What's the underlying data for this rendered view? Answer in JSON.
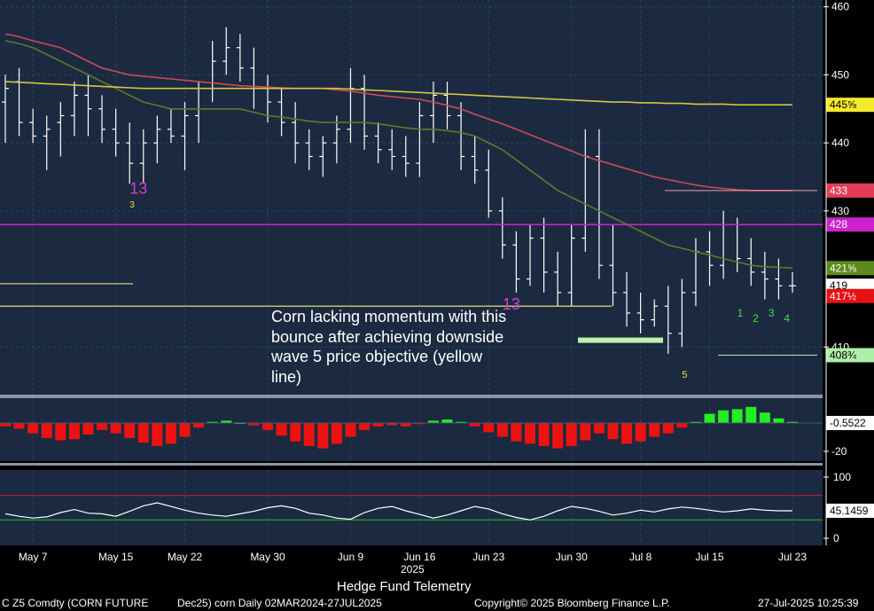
{
  "footer": {
    "ticker": "C Z5 Comdty (CORN FUTURE",
    "contract": "Dec25) corn  Daily 02MAR2024-27JUL2025",
    "copyright": "Copyright© 2025 Bloomberg Finance L.P.",
    "timestamp": "27-Jul-2025 10:25:39"
  },
  "colors": {
    "background": "#1b2a40",
    "up_candle": "#ffffff",
    "ma_short": "#5e7a2a",
    "ma_mid": "#d0485a",
    "ma_long": "#d6c442",
    "level_yellow": "#e4e070",
    "level_magenta": "#d020d0",
    "momentum_up": "#22ee22",
    "momentum_down": "#ee1111"
  },
  "chart_data": {
    "type": "line",
    "title": "Hedge Fund Telemetry",
    "year_label": "2025",
    "annotation": "Corn lacking momentum with this bounce after achieving downside wave 5 price objective (yellow line)",
    "x_labels": [
      "May 7",
      "May 15",
      "May 22",
      "May 30",
      "Jun 9",
      "Jun 16",
      "Jun 23",
      "Jun 30",
      "Jul 8",
      "Jul 15",
      "Jul 23"
    ],
    "x_label_index": [
      2,
      8,
      13,
      19,
      25,
      30,
      35,
      41,
      46,
      51,
      57
    ],
    "price_axis": {
      "ticks": [
        460,
        450,
        440,
        430,
        410
      ],
      "ylim": [
        403,
        461
      ]
    },
    "price_badges": [
      {
        "label": "445⅝",
        "value": 445.6,
        "color": "#f3ea2a"
      },
      {
        "label": "433",
        "value": 433,
        "color": "#e43d5a"
      },
      {
        "label": "428",
        "value": 428,
        "color": "#cc22cc"
      },
      {
        "label": "421⅝",
        "value": 421.6,
        "color": "#5c8a1c"
      },
      {
        "label": "419",
        "value": 419,
        "color": "#ffffff"
      },
      {
        "label": "417½",
        "value": 417.5,
        "color": "#e81111"
      },
      {
        "label": "408¾",
        "value": 408.8,
        "color": "#aef0a8"
      }
    ],
    "ohlc": [
      [
        446,
        450,
        440,
        448
      ],
      [
        449,
        451,
        441,
        443
      ],
      [
        443,
        445,
        440,
        441
      ],
      [
        441,
        444,
        436,
        442
      ],
      [
        443,
        446,
        438,
        444
      ],
      [
        444,
        449,
        441,
        447
      ],
      [
        447,
        450,
        441,
        445
      ],
      [
        445,
        447,
        440,
        442
      ],
      [
        442,
        445,
        438,
        440
      ],
      [
        440,
        443,
        434,
        437
      ],
      [
        437,
        442,
        434,
        440
      ],
      [
        440,
        444,
        437,
        442
      ],
      [
        442,
        445,
        440,
        441
      ],
      [
        441,
        446,
        436,
        444
      ],
      [
        444,
        449,
        440,
        448
      ],
      [
        448,
        455,
        446,
        452
      ],
      [
        452,
        457,
        450,
        454
      ],
      [
        454,
        456,
        449,
        451
      ],
      [
        451,
        454,
        445,
        448
      ],
      [
        448,
        450,
        443,
        446
      ],
      [
        446,
        448,
        441,
        443
      ],
      [
        443,
        446,
        437,
        440
      ],
      [
        440,
        442,
        436,
        438
      ],
      [
        438,
        441,
        435,
        440
      ],
      [
        440,
        444,
        437,
        442
      ],
      [
        442,
        451,
        440,
        448
      ],
      [
        448,
        450,
        439,
        441
      ],
      [
        441,
        443,
        437,
        439
      ],
      [
        439,
        442,
        436,
        438
      ],
      [
        438,
        441,
        435,
        437
      ],
      [
        437,
        446,
        435,
        444
      ],
      [
        444,
        449,
        440,
        447
      ],
      [
        447,
        449,
        442,
        444
      ],
      [
        444,
        446,
        436,
        438
      ],
      [
        438,
        441,
        434,
        436
      ],
      [
        436,
        439,
        429,
        430
      ],
      [
        430,
        432,
        423,
        425
      ],
      [
        425,
        427,
        418,
        420
      ],
      [
        420,
        428,
        419,
        426
      ],
      [
        426,
        429,
        418,
        421
      ],
      [
        421,
        424,
        416,
        418
      ],
      [
        418,
        428,
        416,
        426
      ],
      [
        426,
        442,
        424,
        438
      ],
      [
        438,
        442,
        420,
        422
      ],
      [
        422,
        428,
        416,
        418
      ],
      [
        418,
        421,
        413,
        415
      ],
      [
        415,
        418,
        412,
        414
      ],
      [
        414,
        417,
        413,
        416
      ],
      [
        416,
        419,
        409,
        412
      ],
      [
        412,
        420,
        410,
        418
      ],
      [
        418,
        426,
        416,
        424
      ],
      [
        424,
        427,
        419,
        422
      ],
      [
        422,
        430,
        420,
        428
      ],
      [
        428,
        429,
        421,
        423
      ],
      [
        423,
        426,
        419,
        421
      ],
      [
        421,
        424,
        417,
        420
      ],
      [
        420,
        423,
        417,
        419
      ],
      [
        419,
        421,
        418,
        419
      ]
    ],
    "series": [
      {
        "name": "",
        "color": "#5e7a2a",
        "values": [
          455,
          454.6,
          454,
          453,
          452,
          451,
          450,
          449,
          448,
          447,
          446,
          445.5,
          445,
          445,
          445,
          445,
          445,
          445,
          444.5,
          444,
          443.8,
          443.5,
          443.2,
          443,
          443,
          443,
          443,
          442.8,
          442.5,
          442.2,
          442,
          442,
          441.8,
          441.5,
          441,
          440,
          439,
          437.5,
          436,
          434.5,
          433,
          432,
          431,
          430,
          429,
          428,
          427,
          426,
          425,
          424.5,
          424,
          423.5,
          423,
          422.5,
          422,
          421.8,
          421.7,
          421.6
        ]
      },
      {
        "name": "",
        "color": "#d0485a",
        "values": [
          456,
          455.6,
          455,
          454.5,
          454,
          453,
          452,
          451,
          450.5,
          450,
          449.8,
          449.6,
          449.4,
          449.2,
          449,
          448.8,
          448.6,
          448.4,
          448.3,
          448.2,
          448.1,
          448,
          448,
          448,
          447.8,
          447.6,
          447.3,
          447,
          446.8,
          446.6,
          446.4,
          446,
          445.5,
          445,
          444.2,
          443.5,
          442.8,
          442,
          441.2,
          440.4,
          439.6,
          438.8,
          438,
          437.4,
          436.8,
          436.2,
          435.6,
          435,
          434.6,
          434.2,
          433.8,
          433.5,
          433.3,
          433.1,
          433,
          433,
          433,
          433
        ]
      },
      {
        "name": "",
        "color": "#d6c442",
        "values": [
          449,
          448.9,
          448.8,
          448.7,
          448.6,
          448.5,
          448.4,
          448.3,
          448.2,
          448.1,
          448,
          448,
          448,
          448,
          448,
          448,
          448,
          448,
          448,
          448,
          448,
          448,
          448,
          448,
          448,
          447.9,
          447.8,
          447.7,
          447.6,
          447.5,
          447.4,
          447.3,
          447.2,
          447.1,
          447,
          446.9,
          446.8,
          446.7,
          446.6,
          446.5,
          446.4,
          446.3,
          446.2,
          446.1,
          446,
          446,
          445.9,
          445.9,
          445.8,
          445.8,
          445.7,
          445.7,
          445.7,
          445.6,
          445.6,
          445.6,
          445.6,
          445.6
        ]
      }
    ],
    "momentum": {
      "ticks": [
        "-20"
      ],
      "last_label": "-0.5522",
      "values": [
        -3,
        -5,
        -9,
        -13,
        -15,
        -14,
        -10,
        -6,
        -9,
        -13,
        -17,
        -20,
        -18,
        -12,
        -4,
        1,
        2,
        0,
        -2,
        -6,
        -11,
        -16,
        -20,
        -22,
        -18,
        -12,
        -6,
        -3,
        -2,
        -3,
        -1,
        2,
        3,
        1,
        -3,
        -8,
        -12,
        -16,
        -18,
        -20,
        -22,
        -20,
        -15,
        -9,
        -14,
        -18,
        -16,
        -12,
        -9,
        -4,
        1,
        8,
        11,
        12,
        14,
        9,
        4,
        1
      ]
    },
    "oscillator": {
      "ticks": [
        "100",
        "0"
      ],
      "last_label": "45.1459",
      "overbought": 70,
      "oversold": 30,
      "values": [
        40,
        36,
        33,
        35,
        42,
        47,
        41,
        40,
        36,
        44,
        53,
        58,
        52,
        46,
        41,
        38,
        36,
        40,
        44,
        50,
        53,
        49,
        41,
        38,
        33,
        31,
        42,
        49,
        52,
        45,
        39,
        33,
        38,
        45,
        52,
        48,
        40,
        34,
        30,
        36,
        45,
        52,
        49,
        44,
        38,
        41,
        46,
        43,
        48,
        51,
        49,
        46,
        43,
        45,
        48,
        46,
        45,
        45
      ]
    }
  }
}
